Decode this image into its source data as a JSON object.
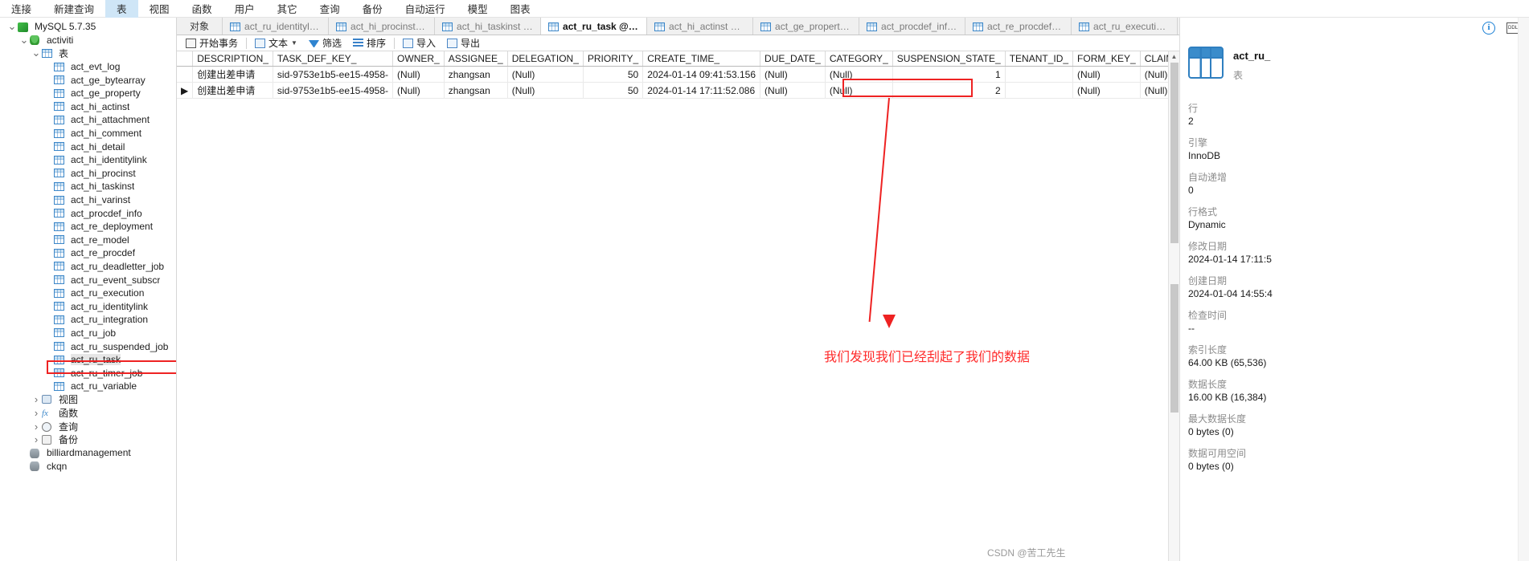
{
  "menubar": {
    "items": [
      {
        "label": "连接",
        "active": false
      },
      {
        "label": "新建查询",
        "active": false
      },
      {
        "label": "表",
        "active": true
      },
      {
        "label": "视图",
        "active": false
      },
      {
        "label": "函数",
        "active": false
      },
      {
        "label": "用户",
        "active": false
      },
      {
        "label": "其它",
        "active": false
      },
      {
        "label": "查询",
        "active": false
      },
      {
        "label": "备份",
        "active": false
      },
      {
        "label": "自动运行",
        "active": false
      },
      {
        "label": "模型",
        "active": false
      },
      {
        "label": "图表",
        "active": false
      }
    ]
  },
  "sidebar": {
    "nodes": [
      {
        "label": "MySQL 5.7.35",
        "indent": 0,
        "chev": "v",
        "icon": "mysql-icon"
      },
      {
        "label": "activiti",
        "indent": 1,
        "chev": "v",
        "icon": "database-icon"
      },
      {
        "label": "表",
        "indent": 2,
        "chev": "v",
        "icon": "table-icon"
      },
      {
        "label": "act_evt_log",
        "indent": 3,
        "chev": "",
        "icon": "table-icon"
      },
      {
        "label": "act_ge_bytearray",
        "indent": 3,
        "chev": "",
        "icon": "table-icon"
      },
      {
        "label": "act_ge_property",
        "indent": 3,
        "chev": "",
        "icon": "table-icon"
      },
      {
        "label": "act_hi_actinst",
        "indent": 3,
        "chev": "",
        "icon": "table-icon"
      },
      {
        "label": "act_hi_attachment",
        "indent": 3,
        "chev": "",
        "icon": "table-icon"
      },
      {
        "label": "act_hi_comment",
        "indent": 3,
        "chev": "",
        "icon": "table-icon"
      },
      {
        "label": "act_hi_detail",
        "indent": 3,
        "chev": "",
        "icon": "table-icon"
      },
      {
        "label": "act_hi_identitylink",
        "indent": 3,
        "chev": "",
        "icon": "table-icon"
      },
      {
        "label": "act_hi_procinst",
        "indent": 3,
        "chev": "",
        "icon": "table-icon"
      },
      {
        "label": "act_hi_taskinst",
        "indent": 3,
        "chev": "",
        "icon": "table-icon"
      },
      {
        "label": "act_hi_varinst",
        "indent": 3,
        "chev": "",
        "icon": "table-icon"
      },
      {
        "label": "act_procdef_info",
        "indent": 3,
        "chev": "",
        "icon": "table-icon"
      },
      {
        "label": "act_re_deployment",
        "indent": 3,
        "chev": "",
        "icon": "table-icon"
      },
      {
        "label": "act_re_model",
        "indent": 3,
        "chev": "",
        "icon": "table-icon"
      },
      {
        "label": "act_re_procdef",
        "indent": 3,
        "chev": "",
        "icon": "table-icon"
      },
      {
        "label": "act_ru_deadletter_job",
        "indent": 3,
        "chev": "",
        "icon": "table-icon"
      },
      {
        "label": "act_ru_event_subscr",
        "indent": 3,
        "chev": "",
        "icon": "table-icon"
      },
      {
        "label": "act_ru_execution",
        "indent": 3,
        "chev": "",
        "icon": "table-icon"
      },
      {
        "label": "act_ru_identitylink",
        "indent": 3,
        "chev": "",
        "icon": "table-icon"
      },
      {
        "label": "act_ru_integration",
        "indent": 3,
        "chev": "",
        "icon": "table-icon"
      },
      {
        "label": "act_ru_job",
        "indent": 3,
        "chev": "",
        "icon": "table-icon"
      },
      {
        "label": "act_ru_suspended_job",
        "indent": 3,
        "chev": "",
        "icon": "table-icon"
      },
      {
        "label": "act_ru_task",
        "indent": 3,
        "chev": "",
        "icon": "table-icon",
        "selected": true
      },
      {
        "label": "act_ru_timer_job",
        "indent": 3,
        "chev": "",
        "icon": "table-icon"
      },
      {
        "label": "act_ru_variable",
        "indent": 3,
        "chev": "",
        "icon": "table-icon"
      },
      {
        "label": "视图",
        "indent": 2,
        "chev": ">",
        "icon": "view-icon"
      },
      {
        "label": "函数",
        "indent": 2,
        "chev": ">",
        "icon": "function-icon"
      },
      {
        "label": "查询",
        "indent": 2,
        "chev": ">",
        "icon": "query-icon"
      },
      {
        "label": "备份",
        "indent": 2,
        "chev": ">",
        "icon": "backup-icon"
      },
      {
        "label": "billiardmanagement",
        "indent": 1,
        "chev": "",
        "icon": "database-gray-icon"
      },
      {
        "label": "ckqn",
        "indent": 1,
        "chev": "",
        "icon": "database-gray-icon"
      }
    ]
  },
  "tabs": {
    "objects_label": "对象",
    "items": [
      {
        "label": "act_ru_identitylink @...",
        "active": false
      },
      {
        "label": "act_hi_procinst @acti...",
        "active": false
      },
      {
        "label": "act_hi_taskinst @acti...",
        "active": false
      },
      {
        "label": "act_ru_task @activiti ...",
        "active": true
      },
      {
        "label": "act_hi_actinst @activi...",
        "active": false
      },
      {
        "label": "act_ge_property @ac...",
        "active": false
      },
      {
        "label": "act_procdef_info @a...",
        "active": false
      },
      {
        "label": "act_re_procdef @acti...",
        "active": false
      },
      {
        "label": "act_ru_execution @a...",
        "active": false
      }
    ]
  },
  "toolbar": {
    "begin_transaction": "开始事务",
    "text": "文本",
    "filter": "筛选",
    "sort": "排序",
    "import": "导入",
    "export": "导出"
  },
  "grid": {
    "columns": [
      "DESCRIPTION_",
      "TASK_DEF_KEY_",
      "OWNER_",
      "ASSIGNEE_",
      "DELEGATION_",
      "PRIORITY_",
      "CREATE_TIME_",
      "DUE_DATE_",
      "CATEGORY_",
      "SUSPENSION_STATE_",
      "TENANT_ID_",
      "FORM_KEY_",
      "CLAIM_TIME_"
    ],
    "rows": [
      {
        "marker": "",
        "cells": [
          "创建出差申请",
          "sid-9753e1b5-ee15-4958-",
          "(Null)",
          "zhangsan",
          "(Null)",
          "50",
          "2024-01-14 09:41:53.156",
          "(Null)",
          "(Null)",
          "1",
          "",
          "(Null)",
          "(Null)"
        ]
      },
      {
        "marker": "▶",
        "cells": [
          "创建出差申请",
          "sid-9753e1b5-ee15-4958-",
          "(Null)",
          "zhangsan",
          "(Null)",
          "50",
          "2024-01-14 17:11:52.086",
          "(Null)",
          "(Null)",
          "2",
          "",
          "(Null)",
          "(Null)"
        ]
      }
    ]
  },
  "annotation": {
    "text": "我们发现我们已经刮起了我们的数据",
    "color": "#ff2a2a"
  },
  "properties": {
    "title": "act_ru_",
    "subtitle": "表",
    "fields": [
      {
        "key": "行",
        "value": "2"
      },
      {
        "key": "引擎",
        "value": "InnoDB"
      },
      {
        "key": "自动递增",
        "value": "0"
      },
      {
        "key": "行格式",
        "value": "Dynamic"
      },
      {
        "key": "修改日期",
        "value": "2024-01-14 17:11:5"
      },
      {
        "key": "创建日期",
        "value": "2024-01-04 14:55:4"
      },
      {
        "key": "检查时间",
        "value": "--"
      },
      {
        "key": "索引长度",
        "value": "64.00 KB (65,536)"
      },
      {
        "key": "数据长度",
        "value": "16.00 KB (16,384)"
      },
      {
        "key": "最大数据长度",
        "value": "0 bytes (0)"
      },
      {
        "key": "数据可用空间",
        "value": "0 bytes (0)"
      }
    ]
  },
  "watermark": "CSDN @苦工先生"
}
